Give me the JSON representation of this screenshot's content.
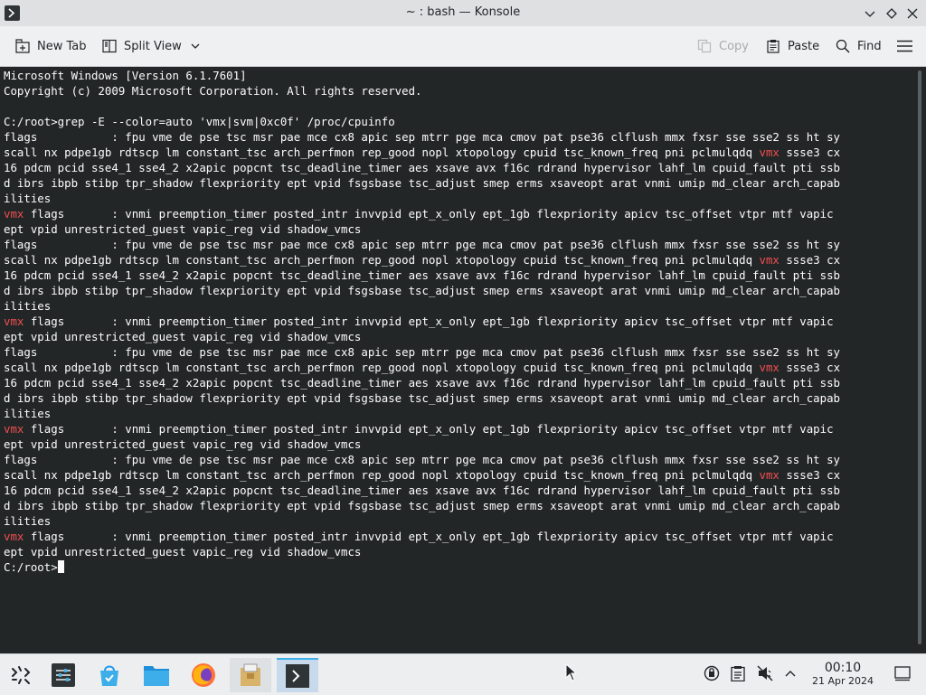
{
  "window": {
    "title": "~ : bash — Konsole"
  },
  "toolbar": {
    "new_tab": "New Tab",
    "split_view": "Split View",
    "copy": "Copy",
    "paste": "Paste",
    "find": "Find"
  },
  "terminal": {
    "highlight_color": "#ed4e50",
    "lines": [
      [
        "Microsoft Windows [Version 6.1.7601]"
      ],
      [
        "Copyright (c) 2009 Microsoft Corporation. All rights reserved."
      ],
      [
        ""
      ],
      [
        "C:/root>grep -E --color=auto 'vmx|svm|0xc0f' /proc/cpuinfo"
      ],
      [
        "flags           : fpu vme de pse tsc msr pae mce cx8 apic sep mtrr pge mca cmov pat pse36 clflush mmx fxsr sse sse2 ss ht sy"
      ],
      [
        "scall nx pdpe1gb rdtscp lm constant_tsc arch_perfmon rep_good nopl xtopology cpuid tsc_known_freq pni pclmulqdq ",
        {
          "hl": "vmx"
        },
        " ssse3 cx"
      ],
      [
        "16 pdcm pcid sse4_1 sse4_2 x2apic popcnt tsc_deadline_timer aes xsave avx f16c rdrand hypervisor lahf_lm cpuid_fault pti ssb"
      ],
      [
        "d ibrs ibpb stibp tpr_shadow flexpriority ept vpid fsgsbase tsc_adjust smep erms xsaveopt arat vnmi umip md_clear arch_capab"
      ],
      [
        "ilities"
      ],
      [
        {
          "hl": "vmx"
        },
        " flags       : vnmi preemption_timer posted_intr invvpid ept_x_only ept_1gb flexpriority apicv tsc_offset vtpr mtf vapic"
      ],
      [
        "ept vpid unrestricted_guest vapic_reg vid shadow_vmcs"
      ],
      [
        "flags           : fpu vme de pse tsc msr pae mce cx8 apic sep mtrr pge mca cmov pat pse36 clflush mmx fxsr sse sse2 ss ht sy"
      ],
      [
        "scall nx pdpe1gb rdtscp lm constant_tsc arch_perfmon rep_good nopl xtopology cpuid tsc_known_freq pni pclmulqdq ",
        {
          "hl": "vmx"
        },
        " ssse3 cx"
      ],
      [
        "16 pdcm pcid sse4_1 sse4_2 x2apic popcnt tsc_deadline_timer aes xsave avx f16c rdrand hypervisor lahf_lm cpuid_fault pti ssb"
      ],
      [
        "d ibrs ibpb stibp tpr_shadow flexpriority ept vpid fsgsbase tsc_adjust smep erms xsaveopt arat vnmi umip md_clear arch_capab"
      ],
      [
        "ilities"
      ],
      [
        {
          "hl": "vmx"
        },
        " flags       : vnmi preemption_timer posted_intr invvpid ept_x_only ept_1gb flexpriority apicv tsc_offset vtpr mtf vapic"
      ],
      [
        "ept vpid unrestricted_guest vapic_reg vid shadow_vmcs"
      ],
      [
        "flags           : fpu vme de pse tsc msr pae mce cx8 apic sep mtrr pge mca cmov pat pse36 clflush mmx fxsr sse sse2 ss ht sy"
      ],
      [
        "scall nx pdpe1gb rdtscp lm constant_tsc arch_perfmon rep_good nopl xtopology cpuid tsc_known_freq pni pclmulqdq ",
        {
          "hl": "vmx"
        },
        " ssse3 cx"
      ],
      [
        "16 pdcm pcid sse4_1 sse4_2 x2apic popcnt tsc_deadline_timer aes xsave avx f16c rdrand hypervisor lahf_lm cpuid_fault pti ssb"
      ],
      [
        "d ibrs ibpb stibp tpr_shadow flexpriority ept vpid fsgsbase tsc_adjust smep erms xsaveopt arat vnmi umip md_clear arch_capab"
      ],
      [
        "ilities"
      ],
      [
        {
          "hl": "vmx"
        },
        " flags       : vnmi preemption_timer posted_intr invvpid ept_x_only ept_1gb flexpriority apicv tsc_offset vtpr mtf vapic"
      ],
      [
        "ept vpid unrestricted_guest vapic_reg vid shadow_vmcs"
      ],
      [
        "flags           : fpu vme de pse tsc msr pae mce cx8 apic sep mtrr pge mca cmov pat pse36 clflush mmx fxsr sse sse2 ss ht sy"
      ],
      [
        "scall nx pdpe1gb rdtscp lm constant_tsc arch_perfmon rep_good nopl xtopology cpuid tsc_known_freq pni pclmulqdq ",
        {
          "hl": "vmx"
        },
        " ssse3 cx"
      ],
      [
        "16 pdcm pcid sse4_1 sse4_2 x2apic popcnt tsc_deadline_timer aes xsave avx f16c rdrand hypervisor lahf_lm cpuid_fault pti ssb"
      ],
      [
        "d ibrs ibpb stibp tpr_shadow flexpriority ept vpid fsgsbase tsc_adjust smep erms xsaveopt arat vnmi umip md_clear arch_capab"
      ],
      [
        "ilities"
      ],
      [
        {
          "hl": "vmx"
        },
        " flags       : vnmi preemption_timer posted_intr invvpid ept_x_only ept_1gb flexpriority apicv tsc_offset vtpr mtf vapic"
      ],
      [
        "ept vpid unrestricted_guest vapic_reg vid shadow_vmcs"
      ]
    ],
    "prompt": "C:/root>"
  },
  "taskbar": {
    "apps": [
      "application-launcher-icon",
      "system-settings-icon",
      "discover-icon",
      "dolphin-icon",
      "firefox-icon",
      "archive-icon",
      "konsole-icon"
    ],
    "tray_icons": [
      "vault-icon",
      "clipboard-icon",
      "volume-muted-icon",
      "chevron-up-icon"
    ]
  },
  "clock": {
    "time": "00:10",
    "date": "21 Apr 2024"
  }
}
